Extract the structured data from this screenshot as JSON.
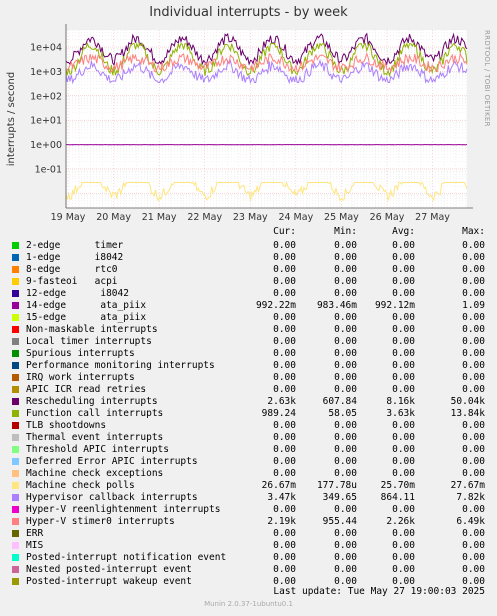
{
  "title": "Individual interrupts - by week",
  "side_label": "RRDTOOL / TOBI OETIKER",
  "footer": "Munin 2.0.37-1ubuntu0.1",
  "last_update": "Last update: Tue May 27 19:00:03 2025",
  "legend_headers": [
    "Cur:",
    "Min:",
    "Avg:",
    "Max:"
  ],
  "chart_data": {
    "type": "line",
    "title": "Individual interrupts - by week",
    "ylabel": "interrupts / second",
    "yscale": "log",
    "ylim": [
      0.0025,
      50000
    ],
    "yticks": [
      "1e-01",
      "1e+00",
      "1e+01",
      "1e+02",
      "1e+03",
      "1e+04"
    ],
    "x_ticks": [
      "19 May",
      "20 May",
      "21 May",
      "22 May",
      "23 May",
      "24 May",
      "25 May",
      "26 May",
      "27 May"
    ],
    "grid": true,
    "legend_placement": "below",
    "series": [
      {
        "name": "2-edge      timer",
        "color": "#00cc00",
        "cur": "0.00",
        "min": "0.00",
        "avg": "0.00",
        "max": "0.00"
      },
      {
        "name": "1-edge      i8042",
        "color": "#0066b3",
        "cur": "0.00",
        "min": "0.00",
        "avg": "0.00",
        "max": "0.00"
      },
      {
        "name": "8-edge      rtc0",
        "color": "#ff8000",
        "cur": "0.00",
        "min": "0.00",
        "avg": "0.00",
        "max": "0.00"
      },
      {
        "name": "9-fasteoi   acpi",
        "color": "#ffcc00",
        "cur": "0.00",
        "min": "0.00",
        "avg": "0.00",
        "max": "0.00"
      },
      {
        "name": "12-edge      i8042",
        "color": "#330099",
        "cur": "0.00",
        "min": "0.00",
        "avg": "0.00",
        "max": "0.00"
      },
      {
        "name": "14-edge      ata_piix",
        "color": "#990099",
        "cur": "992.22m",
        "min": "983.46m",
        "avg": "992.12m",
        "max": "1.09"
      },
      {
        "name": "15-edge      ata_piix",
        "color": "#ccff00",
        "cur": "0.00",
        "min": "0.00",
        "avg": "0.00",
        "max": "0.00"
      },
      {
        "name": "Non-maskable interrupts",
        "color": "#ff0000",
        "cur": "0.00",
        "min": "0.00",
        "avg": "0.00",
        "max": "0.00"
      },
      {
        "name": "Local timer interrupts",
        "color": "#808080",
        "cur": "0.00",
        "min": "0.00",
        "avg": "0.00",
        "max": "0.00"
      },
      {
        "name": "Spurious interrupts",
        "color": "#008f00",
        "cur": "0.00",
        "min": "0.00",
        "avg": "0.00",
        "max": "0.00"
      },
      {
        "name": "Performance monitoring interrupts",
        "color": "#00487d",
        "cur": "0.00",
        "min": "0.00",
        "avg": "0.00",
        "max": "0.00"
      },
      {
        "name": "IRQ work interrupts",
        "color": "#b35a00",
        "cur": "0.00",
        "min": "0.00",
        "avg": "0.00",
        "max": "0.00"
      },
      {
        "name": "APIC ICR read retries",
        "color": "#b38f00",
        "cur": "0.00",
        "min": "0.00",
        "avg": "0.00",
        "max": "0.00"
      },
      {
        "name": "Rescheduling interrupts",
        "color": "#6b006b",
        "cur": "2.63k",
        "min": "607.84",
        "avg": "8.16k",
        "max": "50.04k"
      },
      {
        "name": "Function call interrupts",
        "color": "#8fb300",
        "cur": "989.24",
        "min": "58.05",
        "avg": "3.63k",
        "max": "13.84k"
      },
      {
        "name": "TLB shootdowns",
        "color": "#b30000",
        "cur": "0.00",
        "min": "0.00",
        "avg": "0.00",
        "max": "0.00"
      },
      {
        "name": "Thermal event interrupts",
        "color": "#bebebe",
        "cur": "0.00",
        "min": "0.00",
        "avg": "0.00",
        "max": "0.00"
      },
      {
        "name": "Threshold APIC interrupts",
        "color": "#80ff80",
        "cur": "0.00",
        "min": "0.00",
        "avg": "0.00",
        "max": "0.00"
      },
      {
        "name": "Deferred Error APIC interrupts",
        "color": "#80c9ff",
        "cur": "0.00",
        "min": "0.00",
        "avg": "0.00",
        "max": "0.00"
      },
      {
        "name": "Machine check exceptions",
        "color": "#ffc080",
        "cur": "0.00",
        "min": "0.00",
        "avg": "0.00",
        "max": "0.00"
      },
      {
        "name": "Machine check polls",
        "color": "#ffe680",
        "cur": "26.67m",
        "min": "177.78u",
        "avg": "25.70m",
        "max": "27.67m"
      },
      {
        "name": "Hypervisor callback interrupts",
        "color": "#aa80ff",
        "cur": "3.47k",
        "min": "349.65",
        "avg": "864.11",
        "max": "7.82k"
      },
      {
        "name": "Hyper-V reenlightenment interrupts",
        "color": "#ee00cc",
        "cur": "0.00",
        "min": "0.00",
        "avg": "0.00",
        "max": "0.00"
      },
      {
        "name": "Hyper-V stimer0 interrupts",
        "color": "#ff8080",
        "cur": "2.19k",
        "min": "955.44",
        "avg": "2.26k",
        "max": "6.49k"
      },
      {
        "name": "ERR",
        "color": "#666600",
        "cur": "0.00",
        "min": "0.00",
        "avg": "0.00",
        "max": "0.00"
      },
      {
        "name": "MIS",
        "color": "#ffbfff",
        "cur": "0.00",
        "min": "0.00",
        "avg": "0.00",
        "max": "0.00"
      },
      {
        "name": "Posted-interrupt notification event",
        "color": "#00ffcc",
        "cur": "0.00",
        "min": "0.00",
        "avg": "0.00",
        "max": "0.00"
      },
      {
        "name": "Nested posted-interrupt event",
        "color": "#cc6699",
        "cur": "0.00",
        "min": "0.00",
        "avg": "0.00",
        "max": "0.00"
      },
      {
        "name": "Posted-interrupt wakeup event",
        "color": "#999900",
        "cur": "0.00",
        "min": "0.00",
        "avg": "0.00",
        "max": "0.00"
      }
    ]
  }
}
